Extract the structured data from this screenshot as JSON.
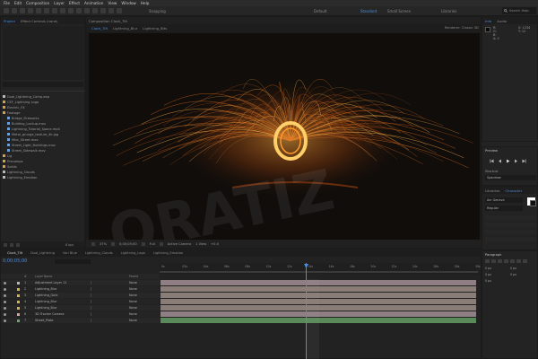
{
  "menu": [
    "File",
    "Edit",
    "Composition",
    "Layer",
    "Effect",
    "Animation",
    "View",
    "Window",
    "Help"
  ],
  "toolbar": {
    "snapping_label": "Snapping",
    "workspaces": [
      "Default",
      "Standard",
      "Small Screen",
      "Libraries"
    ],
    "active_workspace_index": 1,
    "search_placeholder": "Search Help"
  },
  "project_panel": {
    "tabs": [
      "Project",
      "Effect Controls (none)"
    ],
    "items": [
      {
        "name": "Dual_Lightning_Comp.aep",
        "color": "#b8b8b8",
        "indent": 0
      },
      {
        "name": "CEF_Lightning Logo",
        "color": "#d4a04a",
        "indent": 0
      },
      {
        "name": "Electric_FX",
        "color": "#d4a04a",
        "indent": 0
      },
      {
        "name": "Footage",
        "color": "#d4a04a",
        "indent": 0
      },
      {
        "name": "Bridge_Fireworks",
        "color": "#6aa0d8",
        "indent": 1
      },
      {
        "name": "Building_Lockup.mov",
        "color": "#6aa0d8",
        "indent": 1
      },
      {
        "name": "Lightning_Tutorial_Space.mp4",
        "color": "#6aa0d8",
        "indent": 1
      },
      {
        "name": "Metal_grunge_texture_4k.jpg",
        "color": "#6aa0d8",
        "indent": 1
      },
      {
        "name": "Misc_Street.mov",
        "color": "#6aa0d8",
        "indent": 1
      },
      {
        "name": "Street_Light_Buildings.mov",
        "color": "#6aa0d8",
        "indent": 1
      },
      {
        "name": "Street_Sidewalk.mov",
        "color": "#6aa0d8",
        "indent": 1
      },
      {
        "name": "Lig",
        "color": "#d4a04a",
        "indent": 0
      },
      {
        "name": "Precomps",
        "color": "#d4a04a",
        "indent": 0
      },
      {
        "name": "Solids",
        "color": "#d4a04a",
        "indent": 0
      },
      {
        "name": "Lightning_Clouds",
        "color": "#b8b8b8",
        "indent": 0
      },
      {
        "name": "Lightning_Emotion",
        "color": "#b8b8b8",
        "indent": 0
      }
    ],
    "bpc": "8 bpc"
  },
  "composition": {
    "panel_title": "Composition Clock_Tilt",
    "tabs": [
      "Clock_Tilt",
      "Lightning_Blur",
      "Lightning_Bits"
    ],
    "active_camera": "Active Camera",
    "renderer_label": "Renderer:",
    "renderer_value": "Classic 3D",
    "watermark": "ORATIZ",
    "zoom": "37%",
    "timecode": "0;00;05;00",
    "resolution": "Full",
    "view": "Active Camera",
    "views": "1 View",
    "offset": "+0.0"
  },
  "info_panel": {
    "tabs": [
      "Info",
      "Audio"
    ],
    "values": [
      "R:",
      "G:",
      "B:",
      "A: 0",
      "X: 1234",
      "Y: 12"
    ]
  },
  "preview_panel": {
    "title": "Preview",
    "shortcut_label": "Shortcut",
    "shortcut_value": "Spacebar"
  },
  "character_panel": {
    "tabs": [
      "Libraries",
      "Character"
    ],
    "font": "Avr Geneva",
    "style": "Regular"
  },
  "paragraph_panel": {
    "title": "Paragraph",
    "fields": [
      "0 px",
      "0 px",
      "0 px",
      "0 px",
      "0 px"
    ]
  },
  "timeline": {
    "tabs": [
      "Clock_Tilt",
      "Dual_Lightning",
      "Vari Blue",
      "Lightning_Clouds",
      "Lightning_Logo",
      "Lightning_Emotion"
    ],
    "current_time": "0;00;05;00",
    "header": {
      "number": "#",
      "name": "Layer Name",
      "parent": "Parent"
    },
    "ruler": [
      "0s",
      "02s",
      "04s",
      "06s",
      "08s",
      "10s",
      "12s",
      "14s",
      "16s",
      "18s",
      "20s",
      "22s",
      "24s",
      "26s",
      "28s",
      "30s"
    ],
    "layers": [
      {
        "num": "1",
        "name": "Adjustment Layer 11",
        "color": "#b7b7b7",
        "parent": "None",
        "bar": "#8f7f84"
      },
      {
        "num": "2",
        "name": "Lightning_Blur",
        "color": "#d8b24a",
        "parent": "None",
        "bar": "#8a7c76"
      },
      {
        "num": "3",
        "name": "Lightning_Gold",
        "color": "#d8b24a",
        "parent": "None",
        "bar": "#8a7c76"
      },
      {
        "num": "4",
        "name": "Lightning_Blur",
        "color": "#d8b24a",
        "parent": "None",
        "bar": "#8a7c76"
      },
      {
        "num": "5",
        "name": "Lightning_Blur",
        "color": "#d8b24a",
        "parent": "None",
        "bar": "#8a7c76"
      },
      {
        "num": "6",
        "name": "3D Tracker Camera",
        "color": "#e0a0a0",
        "parent": "None",
        "bar": "#8f7f84"
      },
      {
        "num": "7",
        "name": "Street_Plate",
        "color": "#6aa86a",
        "parent": "None",
        "bar": "#5a8a5a"
      }
    ]
  }
}
